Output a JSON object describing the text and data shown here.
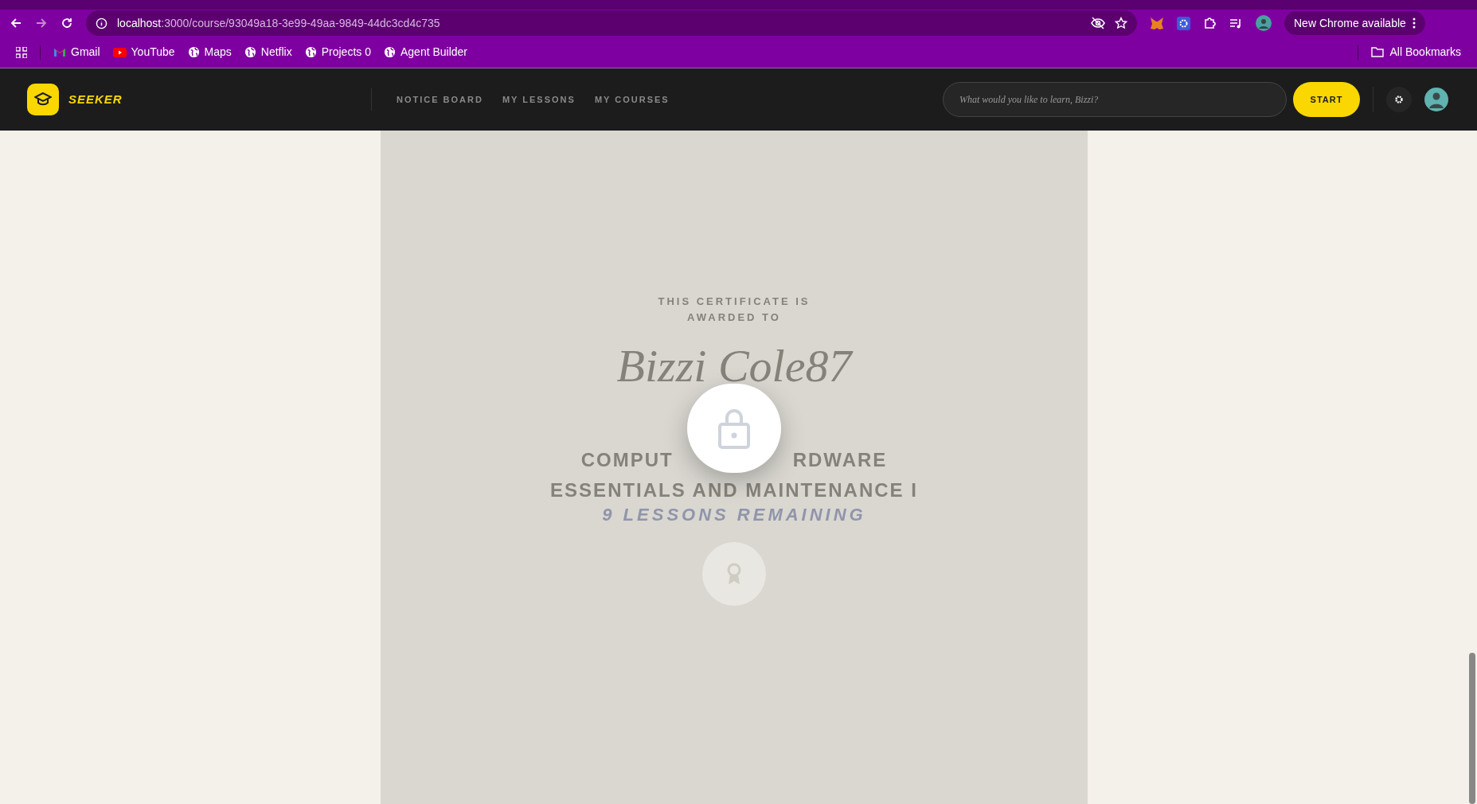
{
  "browser": {
    "url_host": "localhost",
    "url_path": ":3000/course/93049a18-3e99-49aa-9849-44dc3cd4c735",
    "update_button": "New Chrome available",
    "bookmarks": [
      {
        "label": "Gmail",
        "kind": "gmail"
      },
      {
        "label": "YouTube",
        "kind": "youtube"
      },
      {
        "label": "Maps",
        "kind": "globe"
      },
      {
        "label": "Netflix",
        "kind": "globe"
      },
      {
        "label": "Projects 0",
        "kind": "globe"
      },
      {
        "label": "Agent Builder",
        "kind": "globe"
      }
    ],
    "all_bookmarks": "All Bookmarks"
  },
  "header": {
    "logo": "SEEKER",
    "nav": [
      "NOTICE BOARD",
      "MY LESSONS",
      "MY COURSES"
    ],
    "search": {
      "placeholder": "What would you like to learn, Bizzi?"
    },
    "start_button": "START"
  },
  "certificate": {
    "awarded_lines": [
      "THIS CERTIFICATE IS",
      "AWARDED TO"
    ],
    "recipient": "Bizzi Cole87",
    "course_lines": [
      [
        "COMPUT",
        "RDWARE"
      ],
      [
        "ESSENTIALS AND MAINTENANCE I"
      ]
    ],
    "locked": true,
    "remaining": "9 LESSONS REMAINING"
  }
}
